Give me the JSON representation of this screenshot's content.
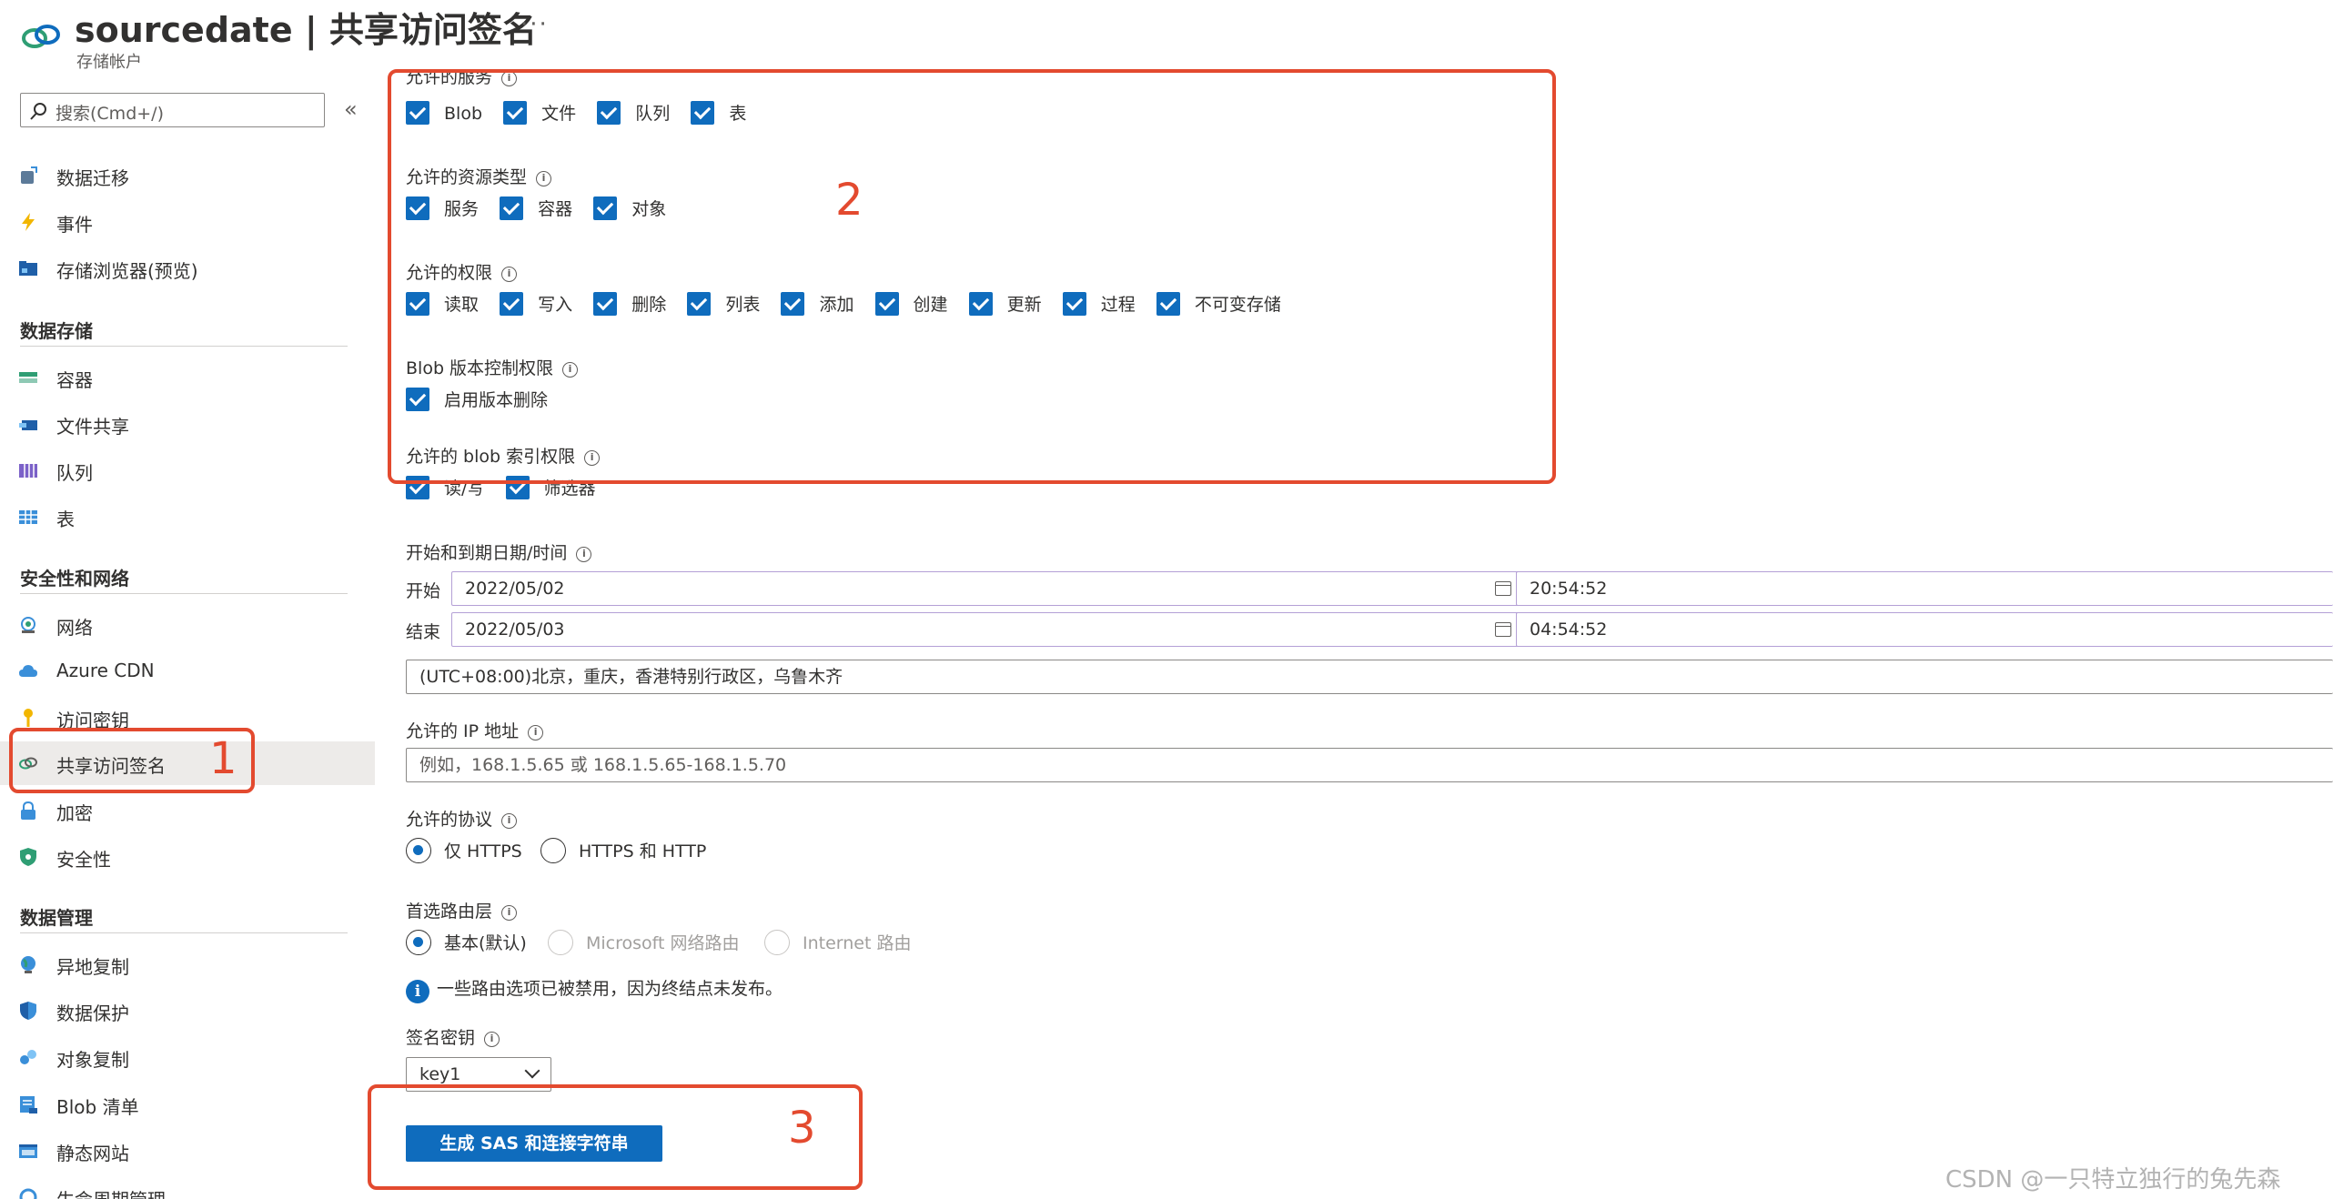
{
  "header": {
    "title": "sourcedate | 共享访问签名",
    "subtitle": "存储帐户",
    "more": "···"
  },
  "sidebar": {
    "search_placeholder": "搜索(Cmd+/)",
    "collapse": "«",
    "cut_item": "数据迁移",
    "items_top": [
      {
        "label": "数据迁移",
        "icon": "data-migration-icon"
      },
      {
        "label": "事件",
        "icon": "lightning-icon"
      },
      {
        "label": "存储浏览器(预览)",
        "icon": "storage-browser-icon"
      }
    ],
    "sections": [
      {
        "title": "数据存储",
        "items": [
          {
            "label": "容器",
            "icon": "container-icon"
          },
          {
            "label": "文件共享",
            "icon": "file-share-icon"
          },
          {
            "label": "队列",
            "icon": "queue-icon"
          },
          {
            "label": "表",
            "icon": "table-icon"
          }
        ]
      },
      {
        "title": "安全性和网络",
        "items": [
          {
            "label": "网络",
            "icon": "network-icon"
          },
          {
            "label": "Azure CDN",
            "icon": "cloud-icon"
          },
          {
            "label": "访问密钥",
            "icon": "key-icon"
          },
          {
            "label": "共享访问签名",
            "icon": "link-icon"
          },
          {
            "label": "加密",
            "icon": "lock-icon"
          },
          {
            "label": "安全性",
            "icon": "shield-icon"
          }
        ]
      },
      {
        "title": "数据管理",
        "items": [
          {
            "label": "异地复制",
            "icon": "globe-icon"
          },
          {
            "label": "数据保护",
            "icon": "data-protection-icon"
          },
          {
            "label": "对象复制",
            "icon": "object-replication-icon"
          },
          {
            "label": "Blob 清单",
            "icon": "inventory-icon"
          },
          {
            "label": "静态网站",
            "icon": "website-icon"
          },
          {
            "label": "生命周期管理",
            "icon": "lifecycle-icon"
          }
        ]
      }
    ]
  },
  "form": {
    "services": {
      "label": "允许的服务",
      "options": [
        "Blob",
        "文件",
        "队列",
        "表"
      ]
    },
    "resource_types": {
      "label": "允许的资源类型",
      "options": [
        "服务",
        "容器",
        "对象"
      ]
    },
    "permissions": {
      "label": "允许的权限",
      "options": [
        "读取",
        "写入",
        "删除",
        "列表",
        "添加",
        "创建",
        "更新",
        "过程",
        "不可变存储"
      ]
    },
    "versioning": {
      "label": "Blob 版本控制权限",
      "options": [
        "启用版本删除"
      ]
    },
    "index": {
      "label": "允许的 blob 索引权限",
      "options": [
        "读/写",
        "筛选器"
      ]
    },
    "datetime": {
      "label": "开始和到期日期/时间",
      "start_label": "开始",
      "start_date": "2022/05/02",
      "start_time": "20:54:52",
      "end_label": "结束",
      "end_date": "2022/05/03",
      "end_time": "04:54:52",
      "timezone": "(UTC+08:00)北京，重庆，香港特别行政区，乌鲁木齐"
    },
    "ip": {
      "label": "允许的 IP 地址",
      "placeholder": "例如，168.1.5.65 或 168.1.5.65-168.1.5.70"
    },
    "protocol": {
      "label": "允许的协议",
      "options": [
        "仅 HTTPS",
        "HTTPS 和 HTTP"
      ],
      "selected": "仅 HTTPS"
    },
    "routing": {
      "label": "首选路由层",
      "options": [
        "基本(默认)",
        "Microsoft 网络路由",
        "Internet 路由"
      ],
      "selected": "基本(默认)"
    },
    "routing_note": "一些路由选项已被禁用，因为终结点未发布。",
    "signing_key": {
      "label": "签名密钥",
      "value": "key1"
    },
    "generate_button": "生成 SAS 和连接字符串"
  },
  "annotations": {
    "one": "1",
    "two": "2",
    "three": "3"
  },
  "watermark": "CSDN @一只特立独行的兔先森",
  "colors": {
    "accent": "#0f6cbd",
    "annotation": "#e34a2f",
    "active_bg": "#edebe9"
  }
}
